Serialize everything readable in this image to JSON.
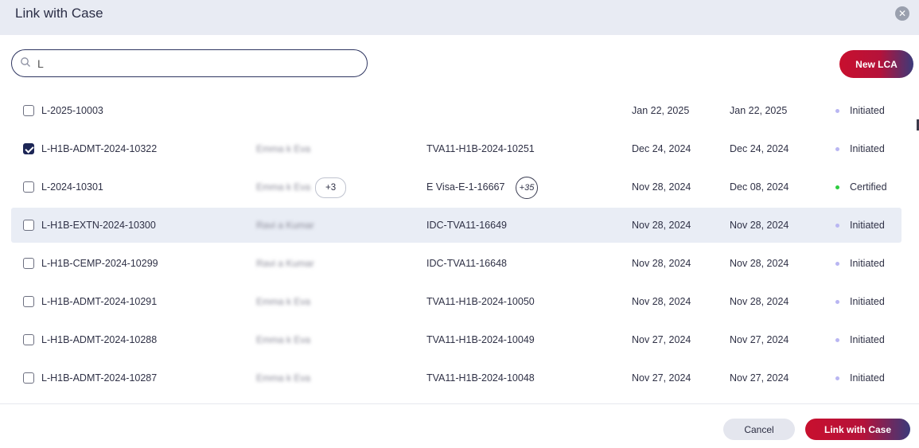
{
  "dialog": {
    "title": "Link with Case",
    "close_icon": "close-icon"
  },
  "search": {
    "value": "L",
    "placeholder": ""
  },
  "buttons": {
    "new_lca": "New LCA",
    "cancel": "Cancel",
    "link": "Link with Case"
  },
  "colors": {
    "accent_red": "#c8102e",
    "accent_navy": "#3b3a7a",
    "initiated": "#b9b6f2",
    "certified": "#2ecc40"
  },
  "rows": [
    {
      "id": "L-2025-10003",
      "name": "",
      "extra_names": "",
      "case": "",
      "case_extra": "",
      "date1": "Jan 22, 2025",
      "date2": "Jan 22, 2025",
      "status": "Initiated",
      "checked": false
    },
    {
      "id": "L-H1B-ADMT-2024-10322",
      "name": "Emma k Eva",
      "extra_names": "",
      "case": "TVA11-H1B-2024-10251",
      "case_extra": "",
      "date1": "Dec 24, 2024",
      "date2": "Dec 24, 2024",
      "status": "Initiated",
      "checked": true
    },
    {
      "id": "L-2024-10301",
      "name": "Emma k Eva",
      "extra_names": "+3",
      "case": "E Visa-E-1-16667",
      "case_extra": "+35",
      "date1": "Nov 28, 2024",
      "date2": "Dec 08, 2024",
      "status": "Certified",
      "checked": false
    },
    {
      "id": "L-H1B-EXTN-2024-10300",
      "name": "Ravi a Kumar",
      "extra_names": "",
      "case": "IDC-TVA11-16649",
      "case_extra": "",
      "date1": "Nov 28, 2024",
      "date2": "Nov 28, 2024",
      "status": "Initiated",
      "checked": false
    },
    {
      "id": "L-H1B-CEMP-2024-10299",
      "name": "Ravi a Kumar",
      "extra_names": "",
      "case": "IDC-TVA11-16648",
      "case_extra": "",
      "date1": "Nov 28, 2024",
      "date2": "Nov 28, 2024",
      "status": "Initiated",
      "checked": false
    },
    {
      "id": "L-H1B-ADMT-2024-10291",
      "name": "Emma k Eva",
      "extra_names": "",
      "case": "TVA11-H1B-2024-10050",
      "case_extra": "",
      "date1": "Nov 28, 2024",
      "date2": "Nov 28, 2024",
      "status": "Initiated",
      "checked": false
    },
    {
      "id": "L-H1B-ADMT-2024-10288",
      "name": "Emma k Eva",
      "extra_names": "",
      "case": "TVA11-H1B-2024-10049",
      "case_extra": "",
      "date1": "Nov 27, 2024",
      "date2": "Nov 27, 2024",
      "status": "Initiated",
      "checked": false
    },
    {
      "id": "L-H1B-ADMT-2024-10287",
      "name": "Emma k Eva",
      "extra_names": "",
      "case": "TVA11-H1B-2024-10048",
      "case_extra": "",
      "date1": "Nov 27, 2024",
      "date2": "Nov 27, 2024",
      "status": "Initiated",
      "checked": false
    }
  ]
}
